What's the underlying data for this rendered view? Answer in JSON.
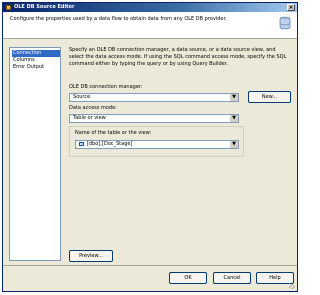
{
  "window": {
    "title": "OLE DB Source Editor",
    "close_glyph": "×"
  },
  "header": {
    "description": "Configure the properties used by a data flow to obtain data from any OLE DB provider."
  },
  "nav": {
    "items": [
      "Connection Manager",
      "Columns",
      "Error Output"
    ],
    "selected": "Connection Manager"
  },
  "main": {
    "description": "Specify an OLE DB connection manager, a data source, or a data source view, and select the data access mode. If using the SQL command access mode, specify the SQL command either by typing the query or by using Query Builder.",
    "connection_label": "OLE DB connection manager:",
    "connection_value": "Source",
    "new_button": "New...",
    "access_mode_label": "Data access mode:",
    "access_mode_value": "Table or view",
    "table_label": "Name of the table or the view:",
    "table_value": "[dbo].[Doc_Stage]",
    "dropdown_glyph": "▼"
  },
  "buttons": {
    "preview": "Preview...",
    "ok": "OK",
    "cancel": "Cancel",
    "help": "Help"
  }
}
